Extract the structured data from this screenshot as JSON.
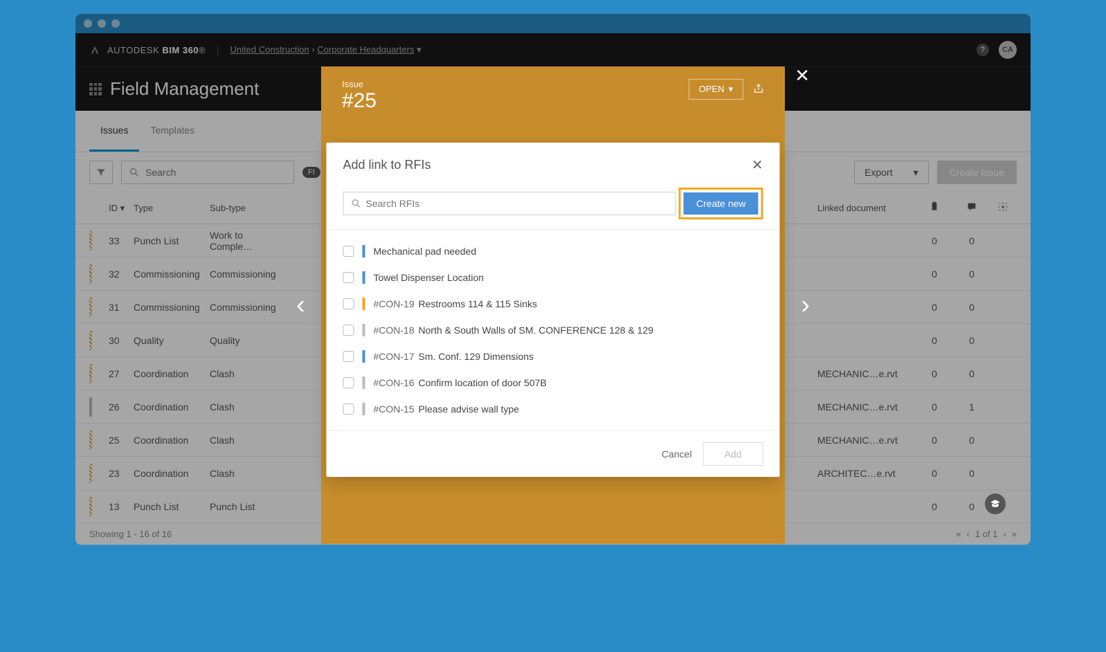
{
  "brand": {
    "a": "AUTODESK",
    "b": "BIM 360"
  },
  "breadcrumb": {
    "org": "United Construction",
    "project": "Corporate Headquarters"
  },
  "avatar_initials": "CA",
  "page_title": "Field Management",
  "tabs": {
    "issues": "Issues",
    "templates": "Templates"
  },
  "search_placeholder": "Search",
  "export_label": "Export",
  "create_issue_label": "Create Issue",
  "filter_badge": "FI",
  "columns": {
    "id": "ID",
    "type": "Type",
    "subtype": "Sub-type",
    "linked": "Linked document"
  },
  "rows": [
    {
      "bar": "orange",
      "id": "33",
      "type": "Punch List",
      "subtype": "Work to Comple…",
      "linked": "",
      "attach": "0",
      "comments": "0"
    },
    {
      "bar": "orange",
      "id": "32",
      "type": "Commissioning",
      "subtype": "Commissioning",
      "linked": "",
      "attach": "0",
      "comments": "0"
    },
    {
      "bar": "orange",
      "id": "31",
      "type": "Commissioning",
      "subtype": "Commissioning",
      "linked": "",
      "attach": "0",
      "comments": "0"
    },
    {
      "bar": "orange",
      "id": "30",
      "type": "Quality",
      "subtype": "Quality",
      "linked": "",
      "attach": "0",
      "comments": "0"
    },
    {
      "bar": "orange",
      "id": "27",
      "type": "Coordination",
      "subtype": "Clash",
      "linked": "MECHANIC…e.rvt",
      "attach": "0",
      "comments": "0"
    },
    {
      "bar": "gray",
      "id": "26",
      "type": "Coordination",
      "subtype": "Clash",
      "linked": "MECHANIC…e.rvt",
      "attach": "0",
      "comments": "1"
    },
    {
      "bar": "orange",
      "id": "25",
      "type": "Coordination",
      "subtype": "Clash",
      "linked": "MECHANIC…e.rvt",
      "attach": "0",
      "comments": "0"
    },
    {
      "bar": "orange",
      "id": "23",
      "type": "Coordination",
      "subtype": "Clash",
      "linked": "ARCHITEC…e.rvt",
      "attach": "0",
      "comments": "0"
    },
    {
      "bar": "orange",
      "id": "13",
      "type": "Punch List",
      "subtype": "Punch List",
      "linked": "",
      "attach": "0",
      "comments": "0"
    }
  ],
  "pagination": {
    "showing": "Showing 1 - 16 of 16",
    "page": "1 of 1"
  },
  "issue_panel": {
    "label": "Issue",
    "number": "#25",
    "status": "OPEN"
  },
  "modal": {
    "title": "Add link to RFIs",
    "search_placeholder": "Search RFIs",
    "create_new": "Create new",
    "cancel": "Cancel",
    "add": "Add",
    "items": [
      {
        "mark": "blue",
        "code": "",
        "title": "Mechanical pad needed"
      },
      {
        "mark": "blue",
        "code": "",
        "title": "Towel Dispenser Location"
      },
      {
        "mark": "orange",
        "code": "#CON-19",
        "title": "Restrooms 114 & 115 Sinks"
      },
      {
        "mark": "gray",
        "code": "#CON-18",
        "title": "North & South Walls of SM. CONFERENCE 128 & 129"
      },
      {
        "mark": "blue",
        "code": "#CON-17",
        "title": "Sm. Conf. 129 Dimensions"
      },
      {
        "mark": "gray",
        "code": "#CON-16",
        "title": "Confirm location of door 507B"
      },
      {
        "mark": "gray",
        "code": "#CON-15",
        "title": "Please advise wall type"
      }
    ]
  }
}
